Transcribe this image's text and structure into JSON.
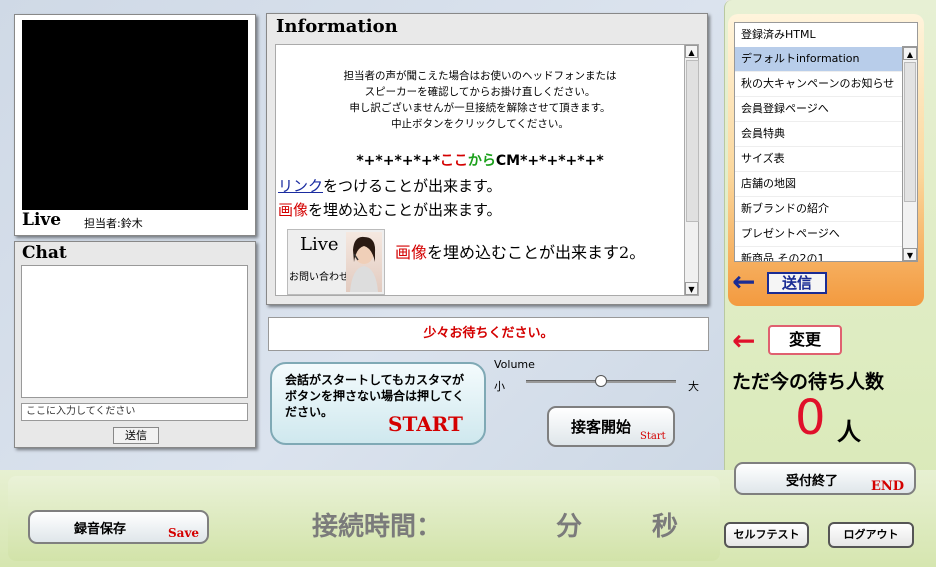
{
  "live": {
    "title": "Live",
    "staff": "担当者:鈴木"
  },
  "chat": {
    "title": "Chat",
    "input_placeholder": "ここに入力してください",
    "send_label": "送信"
  },
  "info": {
    "title": "Information",
    "notice_lines": [
      "担当者の声が聞こえた場合はお使いのヘッドフォンまたは",
      "スピーカーを確認してからお掛け直しください。",
      "申し訳ございませんが一旦接続を解除させて頂きます。",
      "中止ボタンをクリックしてください。"
    ],
    "cm_prefix": "*+*+*+*+*",
    "cm_koko": "ここ",
    "cm_kara": "から",
    "cm_text": "CM",
    "cm_suffix": "*+*+*+*+*",
    "link_word": "リンク",
    "link_rest": "をつけることが出来ます。",
    "image_word": "画像",
    "image_rest": "を埋め込むことが出来ます。",
    "thumb_live": "Live",
    "thumb_contact": "お問い合わせ",
    "image_word2": "画像",
    "image_rest2": "を埋め込むことが出来ます2。"
  },
  "wait_banner": "少々お待ちください。",
  "start": {
    "message": "会話がスタートしてもカスタマがボタンを押さない場合は押してください。",
    "label": "START"
  },
  "volume": {
    "label": "Volume",
    "small": "小",
    "large": "大",
    "level": 0.5
  },
  "serve": {
    "label": "接客開始",
    "sub": "Start"
  },
  "html_list": {
    "items": [
      "登録済みHTML",
      "デフォルトinformation",
      "秋の大キャンペーンのお知らせ",
      "会員登録ページへ",
      "会員特典",
      "サイズ表",
      "店舗の地図",
      "新ブランドの紹介",
      "プレゼントページへ",
      "新商品 その2の1"
    ],
    "selected_index": 1
  },
  "send_label": "送信",
  "change_label": "変更",
  "wait_label": "ただ今の待ち人数",
  "wait_count": "0",
  "wait_unit": "人",
  "end": {
    "label": "受付終了",
    "sub": "END"
  },
  "selftest_label": "セルフテスト",
  "logout_label": "ログアウト",
  "record": {
    "label": "録音保存",
    "sub": "Save"
  },
  "connection": {
    "label": "接続時間：",
    "minutes": "分",
    "seconds": "秒"
  },
  "colors": {
    "accent_red": "#d40000",
    "navy": "#1a2c94",
    "orange": "#f39a3f",
    "green_bg": "#d6e6b0"
  }
}
